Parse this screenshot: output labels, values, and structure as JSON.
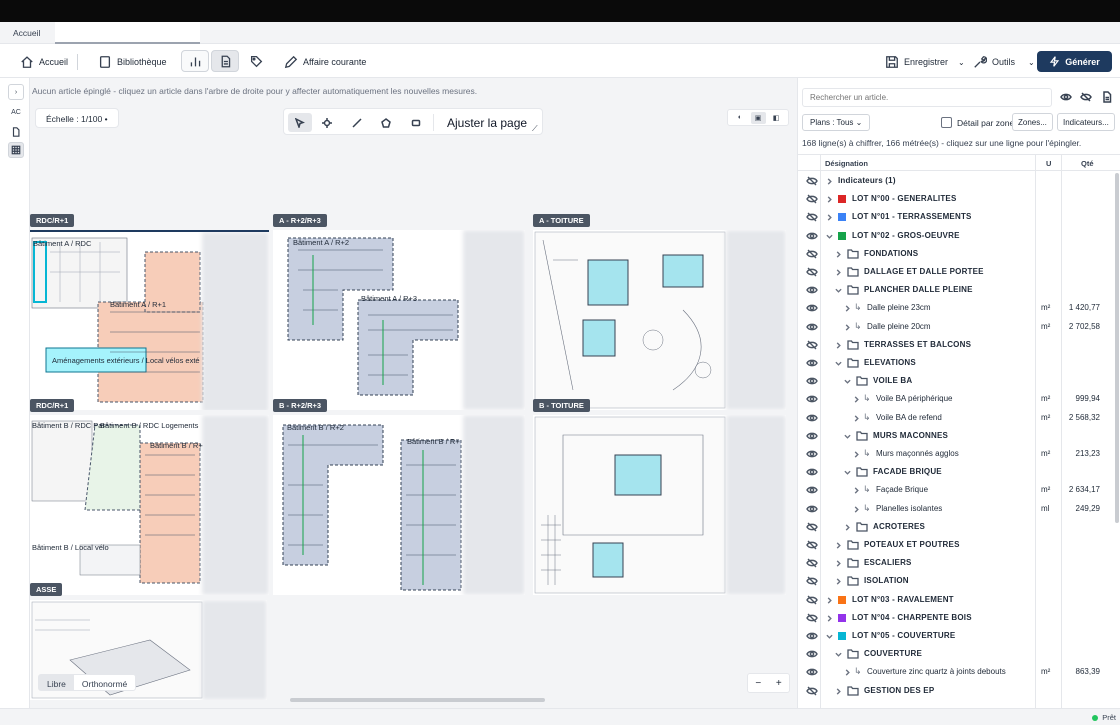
{
  "tabs": {
    "home": "Accueil"
  },
  "toolbar": {
    "home": "Accueil",
    "library": "Bibliothèque",
    "current_case": "Affaire courante",
    "save": "Enregistrer",
    "tools": "Outils",
    "generate": "Générer"
  },
  "left_rail": {
    "ac": "AC"
  },
  "canvas": {
    "info": "Aucun article épinglé - cliquez un article dans l'arbre de droite pour y affecter automatiquement les nouvelles mesures.",
    "scale": "Échelle : 1/100 •",
    "fit_page": "Ajuster la page",
    "modes": [
      "Libre",
      "Orthonormé"
    ],
    "zoom_out": "−",
    "zoom_in": "+"
  },
  "plans": [
    {
      "label": "RDC/R+1",
      "texts": [
        "Bâtiment A / RDC",
        "Bâtiment A / R+1",
        "Aménagements extérieurs / Local vélos exté"
      ]
    },
    {
      "label": "A - R+2/R+3",
      "texts": [
        "Bâtiment A / R+2",
        "Bâtiment A / R+3"
      ]
    },
    {
      "label": "A - TOITURE",
      "texts": []
    },
    {
      "label": "RDC/R+1",
      "texts": [
        "Bâtiment B / RDC Par",
        "Bâtiment B / RDC Logements",
        "Bâtiment B / R+",
        "Bâtiment B / Local vélo"
      ]
    },
    {
      "label": "B - R+2/R+3",
      "texts": [
        "Bâtiment B / R+2",
        "Bâtiment B / R+"
      ]
    },
    {
      "label": "B - TOITURE",
      "texts": []
    },
    {
      "label": "ASSE",
      "texts": []
    }
  ],
  "panel": {
    "search_placeholder": "Rechercher un article.",
    "plans_select": "Plans : Tous",
    "detail_by_zone": "Détail par zone",
    "zones_btn": "Zones...",
    "indicators_btn": "Indicateurs...",
    "count": "168 ligne(s) à chiffrer, 166 métrée(s) - cliquez sur une ligne pour l'épingler.",
    "col_designation": "Désignation",
    "col_unit": "U",
    "col_qty": "Qté"
  },
  "rows": [
    {
      "level": 0,
      "chev": "right",
      "label": "Indicateurs (1)",
      "bold": true,
      "eye": "off",
      "kind": "plain"
    },
    {
      "level": 0,
      "chev": "right",
      "label": "LOT N°00 - GENERALITES",
      "bold": true,
      "eye": "off",
      "kind": "lot",
      "color": "#dc2626"
    },
    {
      "level": 0,
      "chev": "right",
      "label": "LOT N°01 - TERRASSEMENTS",
      "bold": true,
      "eye": "off",
      "kind": "lot",
      "color": "#3b82f6"
    },
    {
      "level": 0,
      "chev": "down",
      "label": "LOT N°02 - GROS-OEUVRE",
      "bold": true,
      "eye": "on",
      "kind": "lot",
      "color": "#16a34a"
    },
    {
      "level": 1,
      "chev": "right",
      "label": "FONDATIONS",
      "bold": true,
      "eye": "off",
      "kind": "folder"
    },
    {
      "level": 1,
      "chev": "right",
      "label": "DALLAGE ET DALLE PORTEE",
      "bold": true,
      "eye": "off",
      "kind": "folder"
    },
    {
      "level": 1,
      "chev": "down",
      "label": "PLANCHER DALLE PLEINE",
      "bold": true,
      "eye": "on",
      "kind": "folder"
    },
    {
      "level": 2,
      "chev": "right",
      "label": "Dalle pleine 23cm",
      "bold": false,
      "eye": "on",
      "kind": "item",
      "unit": "m²",
      "qty": "1 420,77"
    },
    {
      "level": 2,
      "chev": "right",
      "label": "Dalle pleine 20cm",
      "bold": false,
      "eye": "on",
      "kind": "item",
      "unit": "m²",
      "qty": "2 702,58"
    },
    {
      "level": 1,
      "chev": "right",
      "label": "TERRASSES ET BALCONS",
      "bold": true,
      "eye": "off",
      "kind": "folder"
    },
    {
      "level": 1,
      "chev": "down",
      "label": "ELEVATIONS",
      "bold": true,
      "eye": "on",
      "kind": "folder"
    },
    {
      "level": 2,
      "chev": "down",
      "label": "VOILE BA",
      "bold": true,
      "eye": "on",
      "kind": "folder"
    },
    {
      "level": 3,
      "chev": "right",
      "label": "Voile BA périphérique",
      "bold": false,
      "eye": "on",
      "kind": "item",
      "unit": "m²",
      "qty": "999,94"
    },
    {
      "level": 3,
      "chev": "right",
      "label": "Voile BA de refend",
      "bold": false,
      "eye": "on",
      "kind": "item",
      "unit": "m²",
      "qty": "2 568,32"
    },
    {
      "level": 2,
      "chev": "down",
      "label": "MURS MACONNES",
      "bold": true,
      "eye": "on",
      "kind": "folder"
    },
    {
      "level": 3,
      "chev": "right",
      "label": "Murs maçonnés agglos",
      "bold": false,
      "eye": "on",
      "kind": "item",
      "unit": "m²",
      "qty": "213,23"
    },
    {
      "level": 2,
      "chev": "down",
      "label": "FACADE BRIQUE",
      "bold": true,
      "eye": "on",
      "kind": "folder"
    },
    {
      "level": 3,
      "chev": "right",
      "label": "Façade Brique",
      "bold": false,
      "eye": "on",
      "kind": "item",
      "unit": "m²",
      "qty": "2 634,17"
    },
    {
      "level": 3,
      "chev": "right",
      "label": "Planelles isolantes",
      "bold": false,
      "eye": "on",
      "kind": "item",
      "unit": "ml",
      "qty": "249,29"
    },
    {
      "level": 2,
      "chev": "right",
      "label": "ACROTERES",
      "bold": true,
      "eye": "off",
      "kind": "folder"
    },
    {
      "level": 1,
      "chev": "right",
      "label": "POTEAUX ET POUTRES",
      "bold": true,
      "eye": "off",
      "kind": "folder"
    },
    {
      "level": 1,
      "chev": "right",
      "label": "ESCALIERS",
      "bold": true,
      "eye": "off",
      "kind": "folder"
    },
    {
      "level": 1,
      "chev": "right",
      "label": "ISOLATION",
      "bold": true,
      "eye": "off",
      "kind": "folder"
    },
    {
      "level": 0,
      "chev": "right",
      "label": "LOT N°03 - RAVALEMENT",
      "bold": true,
      "eye": "off",
      "kind": "lot",
      "color": "#f97316"
    },
    {
      "level": 0,
      "chev": "right",
      "label": "LOT N°04 - CHARPENTE BOIS",
      "bold": true,
      "eye": "off",
      "kind": "lot",
      "color": "#9333ea"
    },
    {
      "level": 0,
      "chev": "down",
      "label": "LOT N°05 - COUVERTURE",
      "bold": true,
      "eye": "on",
      "kind": "lot",
      "color": "#06b6d4"
    },
    {
      "level": 1,
      "chev": "down",
      "label": "COUVERTURE",
      "bold": true,
      "eye": "on",
      "kind": "folder"
    },
    {
      "level": 2,
      "chev": "right",
      "label": "Couverture zinc quartz à joints debouts",
      "bold": false,
      "eye": "on",
      "kind": "item",
      "unit": "m²",
      "qty": "863,39"
    },
    {
      "level": 1,
      "chev": "right",
      "label": "GESTION DES EP",
      "bold": true,
      "eye": "off",
      "kind": "folder"
    }
  ],
  "status": {
    "text": "Prêt"
  }
}
